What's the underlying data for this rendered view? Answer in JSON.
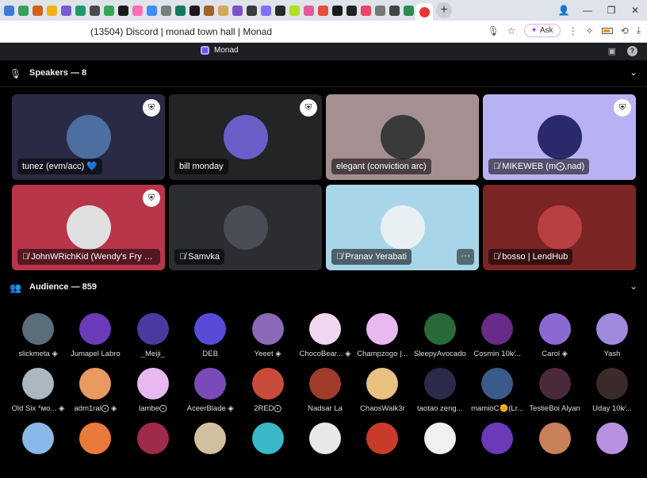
{
  "browser": {
    "tab_colors": [
      "#3d7bd6",
      "#3a9e5a",
      "#d1621d",
      "#f3b316",
      "#7a5cd1",
      "#1d9c6c",
      "#4a4a4a",
      "#3aa655",
      "#1a1a1a",
      "#ff6fb2",
      "#3b8ff3",
      "#7b7f7a",
      "#147a5c",
      "#1a1a1a",
      "#a0622a",
      "#d2a85a",
      "#7b52c7",
      "#3a3a3a",
      "#8070ff",
      "#2a2a2a",
      "#b0e020",
      "#e25a9a",
      "#e84c3d",
      "#1a1a1a",
      "#222",
      "#ef4466",
      "#777",
      "#444",
      "#2e8c50"
    ],
    "page_title": "(13504) Discord | monad town hall | Monad",
    "ask_label": "Ask",
    "new_tab_symbol": "+"
  },
  "discord": {
    "server_name": "Monad"
  },
  "speakers": {
    "header": "Speakers — 8",
    "cards": [
      {
        "name": "tunez (evm/acc) 💙",
        "bg": "#2a2a44",
        "avatar": "#4a6fa0",
        "mod": true,
        "muted": false,
        "more": false
      },
      {
        "name": "bill monday",
        "bg": "#222426",
        "avatar": "#6a5ec8",
        "mod": true,
        "muted": false,
        "more": false
      },
      {
        "name": "elegant (conviction arc)",
        "bg": "#a58f92",
        "avatar": "#3a3a3a",
        "mod": false,
        "muted": false,
        "more": false
      },
      {
        "name": "MIKEWEB (m⨀,nad)",
        "bg": "#b9b2f2",
        "avatar": "#2a2a6a",
        "mod": true,
        "muted": true,
        "more": false
      },
      {
        "name": "JohnWRichKid (Wendy's Fry C...",
        "bg": "#b8354a",
        "avatar": "#e0e0e0",
        "mod": true,
        "muted": true,
        "more": false
      },
      {
        "name": "Samvka",
        "bg": "#2b2d31",
        "avatar": "#4a4d55",
        "mod": false,
        "muted": true,
        "more": false
      },
      {
        "name": "Pranav Yerabati",
        "bg": "#a8d6e8",
        "avatar": "#e8f0f4",
        "mod": false,
        "muted": true,
        "more": true
      },
      {
        "name": "bosso | LendHub",
        "bg": "#7a2424",
        "avatar": "#b84040",
        "mod": false,
        "muted": true,
        "more": false
      }
    ]
  },
  "audience": {
    "header": "Audience — 859",
    "members": [
      {
        "name": "slickmeta",
        "badge": true,
        "color": "#5a6e7a"
      },
      {
        "name": "Jumapel Labro",
        "badge": false,
        "color": "#6a3ab8"
      },
      {
        "name": "_Meiji_",
        "badge": false,
        "color": "#4a3aa0"
      },
      {
        "name": "DEB",
        "badge": false,
        "color": "#5a4ad8"
      },
      {
        "name": "Yeeet",
        "badge": true,
        "color": "#8a6ab8"
      },
      {
        "name": "ChocoBear...",
        "badge": true,
        "color": "#f0d8f0"
      },
      {
        "name": "Champzogo |...",
        "badge": false,
        "color": "#e8b8f0"
      },
      {
        "name": "SleepyAvocado",
        "badge": false,
        "color": "#2a6a3a"
      },
      {
        "name": "Cosmin 10k⁄...",
        "badge": false,
        "color": "#6a2a8a"
      },
      {
        "name": "Carol",
        "badge": true,
        "color": "#8a6ad0"
      },
      {
        "name": "Yash",
        "badge": false,
        "color": "#a08ae0"
      },
      {
        "name": "Old Six *мо...",
        "badge": true,
        "color": "#aab8c0"
      },
      {
        "name": "adm1ral⨀",
        "badge": true,
        "color": "#e89a60"
      },
      {
        "name": "lambe⨀",
        "badge": false,
        "color": "#e8b8f0"
      },
      {
        "name": "AceerBlade",
        "badge": true,
        "color": "#7a4ab8"
      },
      {
        "name": "2RED⨀",
        "badge": false,
        "color": "#c84a3a"
      },
      {
        "name": "Nadsar La",
        "badge": false,
        "color": "#a03a2a"
      },
      {
        "name": "ChaosWalk3r",
        "badge": false,
        "color": "#e8c080"
      },
      {
        "name": "taotao zeng...",
        "badge": false,
        "color": "#2a2a4a"
      },
      {
        "name": "mamioC🌞(Lr...",
        "badge": false,
        "color": "#3a5a8a"
      },
      {
        "name": "TestieBoi Alyan",
        "badge": false,
        "color": "#4a2a3a"
      },
      {
        "name": "Uday 10k⁄...",
        "badge": false,
        "color": "#3a2a2a"
      },
      {
        "name": "",
        "badge": false,
        "color": "#8ab8e8"
      },
      {
        "name": "",
        "badge": false,
        "color": "#e87a3a"
      },
      {
        "name": "",
        "badge": false,
        "color": "#a02a4a"
      },
      {
        "name": "",
        "badge": false,
        "color": "#d0c0a0"
      },
      {
        "name": "",
        "badge": false,
        "color": "#3ab8c8"
      },
      {
        "name": "",
        "badge": false,
        "color": "#e8e8e8"
      },
      {
        "name": "",
        "badge": false,
        "color": "#c83a2a"
      },
      {
        "name": "",
        "badge": false,
        "color": "#f0f0f0"
      },
      {
        "name": "",
        "badge": false,
        "color": "#6a3ab8"
      },
      {
        "name": "",
        "badge": false,
        "color": "#c8805a"
      },
      {
        "name": "",
        "badge": false,
        "color": "#b890e0"
      }
    ]
  }
}
